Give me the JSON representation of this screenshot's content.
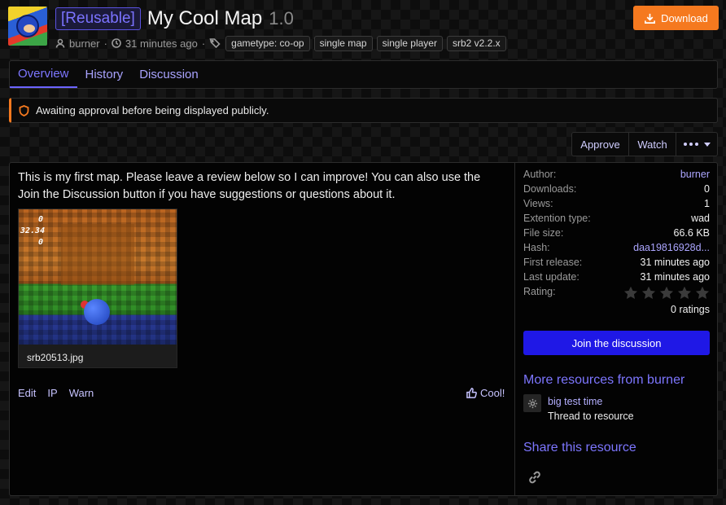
{
  "header": {
    "prefix": "[Reusable]",
    "title": "My Cool Map",
    "version": "1.0",
    "author": "burner",
    "separator": "·",
    "time": "31 minutes ago",
    "tags": [
      "gametype: co-op",
      "single map",
      "single player",
      "srb2 v2.2.x"
    ],
    "download_label": "Download"
  },
  "tabs": [
    {
      "label": "Overview",
      "active": true
    },
    {
      "label": "History",
      "active": false
    },
    {
      "label": "Discussion",
      "active": false
    }
  ],
  "notice": {
    "text": "Awaiting approval before being displayed publicly."
  },
  "actions": {
    "approve": "Approve",
    "watch": "Watch"
  },
  "content": {
    "description": "This is my first map. Please leave a review below so I can improve! You can also use the Join the Discussion button if you have suggestions or questions about it.",
    "attachment": {
      "filename": "srb20513.jpg",
      "hud_line1": "0",
      "hud_line2": "32.34",
      "hud_line3": "0"
    },
    "post_actions": [
      "Edit",
      "IP",
      "Warn"
    ],
    "reaction_label": "Cool!"
  },
  "sidebar": {
    "info": [
      {
        "key": "Author:",
        "value": "burner",
        "link": true
      },
      {
        "key": "Downloads:",
        "value": "0",
        "link": false
      },
      {
        "key": "Views:",
        "value": "1",
        "link": false
      },
      {
        "key": "Extention type:",
        "value": "wad",
        "link": false
      },
      {
        "key": "File size:",
        "value": "66.6 KB",
        "link": false
      },
      {
        "key": "Hash:",
        "value": "daa19816928d...",
        "link": true
      },
      {
        "key": "First release:",
        "value": "31 minutes ago",
        "link": false
      },
      {
        "key": "Last update:",
        "value": "31 minutes ago",
        "link": false
      }
    ],
    "rating_label": "Rating:",
    "rating_stars": 0,
    "rating_max": 5,
    "ratings_count": "0 ratings",
    "join_label": "Join the discussion",
    "more_resources_title": "More resources from burner",
    "more_resources": [
      {
        "title": "big test time",
        "subtitle": "Thread to resource"
      }
    ],
    "share_title": "Share this resource"
  },
  "colors": {
    "accent": "#7d76ff",
    "download": "#f5791f",
    "join": "#1f18e6",
    "notice_border": "#f5791f"
  }
}
